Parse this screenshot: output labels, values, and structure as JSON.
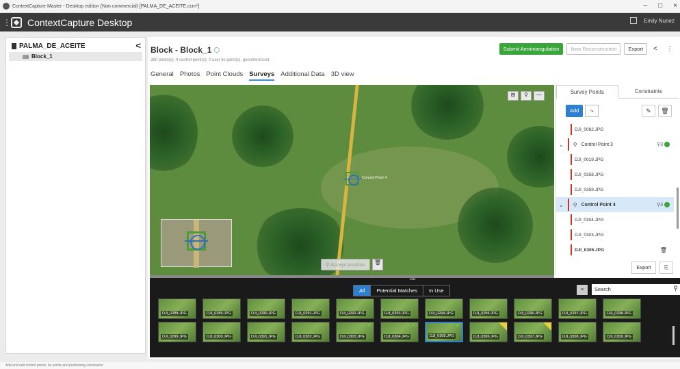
{
  "window": {
    "title": "ContextCapture Master - Desktop edition (Non commercial) [PALMA_DE_ACEITE.ccm*]",
    "controls": [
      "–",
      "□",
      "×"
    ]
  },
  "app": {
    "name": "ContextCapture Desktop",
    "user": "Emily Nunez"
  },
  "sidebar": {
    "project": "PALMA_DE_ACEITE",
    "collapse": "<",
    "items": [
      {
        "label": "Block_1"
      }
    ]
  },
  "block": {
    "title": "Block - Block_1",
    "subtitle": "360 photo(s), 4 control point(s), 0 user tie point(s), georeferenced",
    "tabs": [
      "General",
      "Photos",
      "Point Clouds",
      "Surveys",
      "Additional Data",
      "3D view"
    ],
    "active_tab": "Surveys",
    "buttons": {
      "submit": "Submit Aerotriangulation",
      "new_recon": "New Reconstruction",
      "export": "Export"
    }
  },
  "viewer": {
    "point_label": "Control Point 4",
    "accept": "Accept position"
  },
  "survey": {
    "tabs": [
      "Survey Points",
      "Constraints"
    ],
    "add": "Add",
    "export": "Export",
    "rows": [
      {
        "kind": "img",
        "name": "DJI_0062.JPG"
      },
      {
        "kind": "cp",
        "name": "Control Point 3",
        "count": "3"
      },
      {
        "kind": "img",
        "name": "DJI_0019.JPG"
      },
      {
        "kind": "img",
        "name": "DJI_0358.JPG"
      },
      {
        "kind": "img",
        "name": "DJI_0359.JPG"
      },
      {
        "kind": "cp",
        "name": "Control Point 4",
        "count": "3",
        "selected": true
      },
      {
        "kind": "img",
        "name": "DJI_0304.JPG"
      },
      {
        "kind": "img",
        "name": "DJI_0303.JPG"
      },
      {
        "kind": "img",
        "name": "DJI_0305.JPG",
        "bold": true
      }
    ]
  },
  "strip": {
    "filters": [
      "All",
      "Potential Matches",
      "In Use"
    ],
    "active_filter": "All",
    "search_placeholder": "Search",
    "thumbs_row1": [
      "DJI_0288.JPG",
      "DJI_0289.JPG",
      "DJI_0290.JPG",
      "DJI_0291.JPG",
      "DJI_0292.JPG",
      "DJI_0293.JPG",
      "DJI_0294.JPG",
      "DJI_0295.JPG",
      "DJI_0296.JPG",
      "DJI_0297.JPG",
      "DJI_0298.JPG"
    ],
    "thumbs_row2": [
      "DJI_0299.JPG",
      "DJI_0300.JPG",
      "DJI_0301.JPG",
      "DJI_0302.JPG",
      "DJI_0303.JPG",
      "DJI_0304.JPG",
      "DJI_0305.JPG",
      "DJI_0306.JPG",
      "DJI_0307.JPG",
      "DJI_0308.JPG",
      "DJI_0309.JPG"
    ],
    "selected_thumb": "DJI_0305.JPG",
    "checked": [
      "DJI_0303.JPG",
      "DJI_0304.JPG",
      "DJI_0305.JPG"
    ],
    "marked": [
      "DJI_0306.JPG",
      "DJI_0307.JPG"
    ]
  },
  "status": {
    "text": "Add and edit control points, tie points and positioning constraints"
  },
  "colors": {
    "accent": "#2f7fd1",
    "submit": "#3aa53a",
    "control_point_bar": "#c0392b"
  }
}
